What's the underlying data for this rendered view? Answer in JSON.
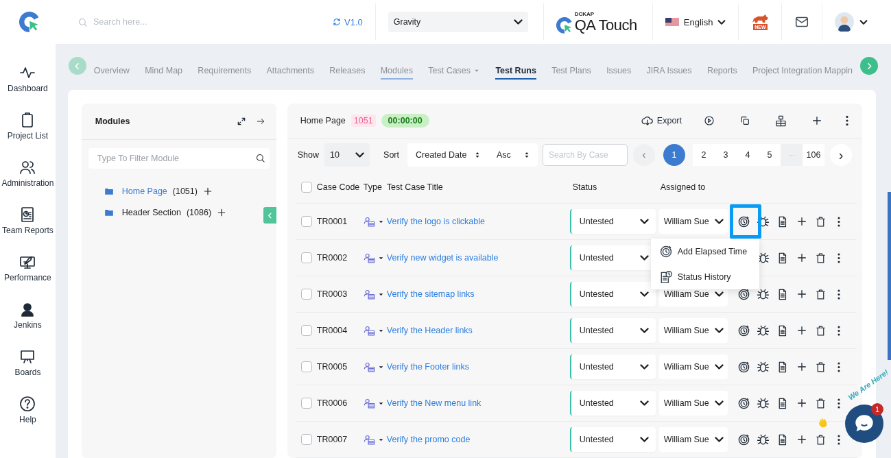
{
  "header": {
    "search": {
      "placeholder": "Search here..."
    },
    "version": "V1.0",
    "project": {
      "value": "Gravity"
    },
    "brand": {
      "company": "DCKAP",
      "product": "QA Touch"
    },
    "language": "English",
    "new_badge": "NEW"
  },
  "sidebar": {
    "items": [
      {
        "label": "Dashboard"
      },
      {
        "label": "Project List"
      },
      {
        "label": "Administration"
      },
      {
        "label": "Team Reports"
      },
      {
        "label": "Performance"
      },
      {
        "label": "Jenkins"
      },
      {
        "label": "Boards"
      },
      {
        "label": "Help"
      }
    ]
  },
  "tabs": [
    {
      "label": "Overview",
      "selected": false,
      "hovered": false,
      "dropdown": false
    },
    {
      "label": "Mind Map",
      "selected": false,
      "hovered": false,
      "dropdown": false
    },
    {
      "label": "Requirements",
      "selected": false,
      "hovered": false,
      "dropdown": false
    },
    {
      "label": "Attachments",
      "selected": false,
      "hovered": false,
      "dropdown": false
    },
    {
      "label": "Releases",
      "selected": false,
      "hovered": false,
      "dropdown": false
    },
    {
      "label": "Modules",
      "selected": false,
      "hovered": true,
      "dropdown": false
    },
    {
      "label": "Test Cases",
      "selected": false,
      "hovered": false,
      "dropdown": true
    },
    {
      "label": "Test Runs",
      "selected": true,
      "hovered": false,
      "dropdown": false
    },
    {
      "label": "Test Plans",
      "selected": false,
      "hovered": false,
      "dropdown": false
    },
    {
      "label": "Issues",
      "selected": false,
      "hovered": false,
      "dropdown": false
    },
    {
      "label": "JIRA Issues",
      "selected": false,
      "hovered": false,
      "dropdown": false
    },
    {
      "label": "Reports",
      "selected": false,
      "hovered": false,
      "dropdown": false
    },
    {
      "label": "Project Integration Mappin",
      "selected": false,
      "hovered": false,
      "dropdown": false
    }
  ],
  "modules": {
    "title": "Modules",
    "filter": {
      "placeholder": "Type To Filter Module"
    },
    "tree": [
      {
        "label": "Home Page",
        "count": "(1051)",
        "selected": true
      },
      {
        "label": "Header Section",
        "count": "(1086)",
        "selected": false
      }
    ]
  },
  "run": {
    "title": "Home Page",
    "count": "1051",
    "timer": "00:00:00",
    "export": "Export",
    "show": {
      "label": "Show",
      "value": "10"
    },
    "sort": {
      "label": "Sort",
      "field": "Created Date",
      "order": "Asc"
    },
    "search": {
      "placeholder": "Search By Case"
    },
    "pagination": {
      "prev": "‹",
      "next": "›",
      "pages": [
        {
          "label": "1",
          "kind": "page",
          "selected": true
        },
        {
          "label": "2",
          "kind": "page",
          "selected": false
        },
        {
          "label": "3",
          "kind": "page",
          "selected": false
        },
        {
          "label": "4",
          "kind": "page",
          "selected": false
        },
        {
          "label": "5",
          "kind": "page",
          "selected": false
        },
        {
          "label": "···",
          "kind": "gap"
        },
        {
          "label": "106",
          "kind": "page",
          "selected": false
        }
      ]
    },
    "select_all": {
      "checked": false
    },
    "columns": [
      "Case Code",
      "Type",
      "Test Case Title",
      "Status",
      "Assigned to"
    ],
    "rows": [
      {
        "code": "TR0001",
        "title": "Verify the logo is clickable",
        "status": "Untested",
        "assignee": "William Sue",
        "checked": false,
        "menu_open": true
      },
      {
        "code": "TR0002",
        "title": "Verify new widget is available",
        "status": "Untested",
        "checked": false,
        "menu_open": false
      },
      {
        "code": "TR0003",
        "title": "Verify the sitemap links",
        "status": "Untested",
        "assignee": "William Sue",
        "checked": false,
        "menu_open": false
      },
      {
        "code": "TR0004",
        "title": "Verify the Header links",
        "status": "Untested",
        "assignee": "William Sue",
        "checked": false,
        "menu_open": false
      },
      {
        "code": "TR0005",
        "title": "Verify the Footer links",
        "status": "Untested",
        "assignee": "William Sue",
        "checked": false,
        "menu_open": false
      },
      {
        "code": "TR0006",
        "title": "Verify the New menu link",
        "status": "Untested",
        "assignee": "William Sue",
        "checked": false,
        "menu_open": false
      },
      {
        "code": "TR0007",
        "title": "Verify the promo code",
        "status": "Untested",
        "assignee": "William Sue",
        "checked": false,
        "menu_open": false
      }
    ],
    "row_menu": {
      "items": [
        {
          "label": "Add Elapsed Time"
        },
        {
          "label": "Status History"
        }
      ]
    }
  },
  "chat": {
    "caption": "We Are Here!",
    "badge": "1"
  }
}
